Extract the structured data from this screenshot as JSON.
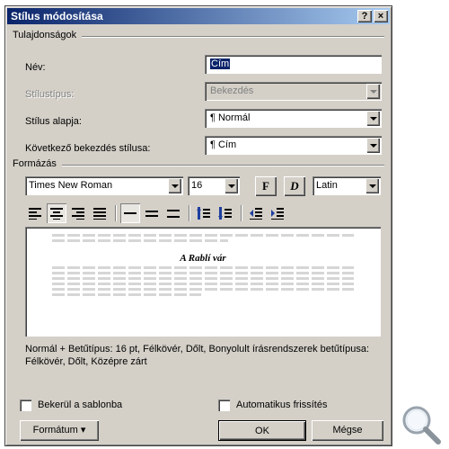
{
  "dialog": {
    "title": "Stílus módosítása",
    "help_label": "?",
    "close_label": "×"
  },
  "properties": {
    "group_title": "Tulajdonságok",
    "name_label": "Név:",
    "name_value": "Cím",
    "type_label": "Stílustípus:",
    "type_value": "Bekezdés",
    "based_on_label": "Stílus alapja:",
    "based_on_value": "¶ Normál",
    "next_label": "Következő bekezdés stílusa:",
    "next_value": "¶ Cím"
  },
  "formatting": {
    "group_title": "Formázás",
    "font": "Times New Roman",
    "size": "16",
    "bold_label": "F",
    "italic_label": "D",
    "script": "Latin"
  },
  "preview": {
    "sample_title": "A Rablí vár"
  },
  "description": "Normál + Betűtípus: 16 pt, Félkövér, Dőlt, Bonyolult írásrendszerek betűtípusa: Félkövér, Dőlt, Középre zárt",
  "options": {
    "add_to_template": "Bekerül a sablonba",
    "auto_update": "Automatikus frissítés"
  },
  "buttons": {
    "format": "Formátum ▾",
    "ok": "OK",
    "cancel": "Mégse"
  },
  "icons": {
    "zoom": "magnifier-icon"
  }
}
